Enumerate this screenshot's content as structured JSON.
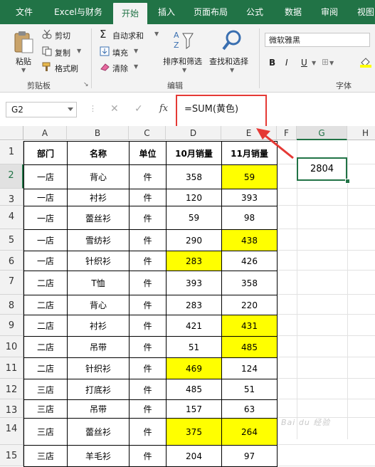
{
  "tabs": [
    "文件",
    "Excel与财务",
    "开始",
    "插入",
    "页面布局",
    "公式",
    "数据",
    "审阅",
    "视图"
  ],
  "active_tab": "开始",
  "ribbon": {
    "paste": "粘贴",
    "cut": "剪切",
    "copy": "复制",
    "format_painter": "格式刷",
    "clipboard_group": "剪贴板",
    "autosum": "自动求和",
    "fill": "填充",
    "clear": "清除",
    "sort_filter": "排序和筛选",
    "find_select": "查找和选择",
    "edit_group": "编辑",
    "font_name": "微软雅黑",
    "bold": "B",
    "italic": "I",
    "underline": "U",
    "font_group": "字体"
  },
  "formula_bar": {
    "name_box": "G2",
    "cancel": "✕",
    "enter": "✓",
    "fx": "fx",
    "formula": "=SUM(黄色)"
  },
  "columns": [
    "A",
    "B",
    "C",
    "D",
    "E",
    "F",
    "G",
    "H"
  ],
  "rows": [
    "1",
    "2",
    "3",
    "4",
    "5",
    "6",
    "7",
    "8",
    "9",
    "10",
    "11",
    "12",
    "13",
    "14",
    "15"
  ],
  "table": {
    "headers": [
      "部门",
      "名称",
      "单位",
      "10月销量",
      "11月销量"
    ],
    "rows": [
      [
        "一店",
        "背心",
        "件",
        "358",
        "59"
      ],
      [
        "一店",
        "衬衫",
        "件",
        "120",
        "393"
      ],
      [
        "一店",
        "蕾丝衫",
        "件",
        "59",
        "98"
      ],
      [
        "一店",
        "雪纺衫",
        "件",
        "290",
        "438"
      ],
      [
        "一店",
        "针织衫",
        "件",
        "283",
        "426"
      ],
      [
        "二店",
        "T恤",
        "件",
        "393",
        "358"
      ],
      [
        "二店",
        "背心",
        "件",
        "283",
        "220"
      ],
      [
        "二店",
        "衬衫",
        "件",
        "421",
        "431"
      ],
      [
        "二店",
        "吊带",
        "件",
        "51",
        "485"
      ],
      [
        "二店",
        "针织衫",
        "件",
        "469",
        "124"
      ],
      [
        "三店",
        "打底衫",
        "件",
        "485",
        "51"
      ],
      [
        "三店",
        "吊带",
        "件",
        "157",
        "63"
      ],
      [
        "三店",
        "蕾丝衫",
        "件",
        "375",
        "264"
      ],
      [
        "三店",
        "羊毛衫",
        "件",
        "204",
        "97"
      ]
    ],
    "highlighted": [
      [
        0,
        4
      ],
      [
        3,
        4
      ],
      [
        4,
        3
      ],
      [
        7,
        4
      ],
      [
        8,
        4
      ],
      [
        9,
        3
      ],
      [
        12,
        3
      ],
      [
        12,
        4
      ]
    ],
    "highlight_color": "#ffff00"
  },
  "result_cell": {
    "address": "G2",
    "value": "2804"
  },
  "watermark": "Bai du 经验",
  "colors": {
    "excel_green": "#217346",
    "annotation_red": "#e53935"
  }
}
